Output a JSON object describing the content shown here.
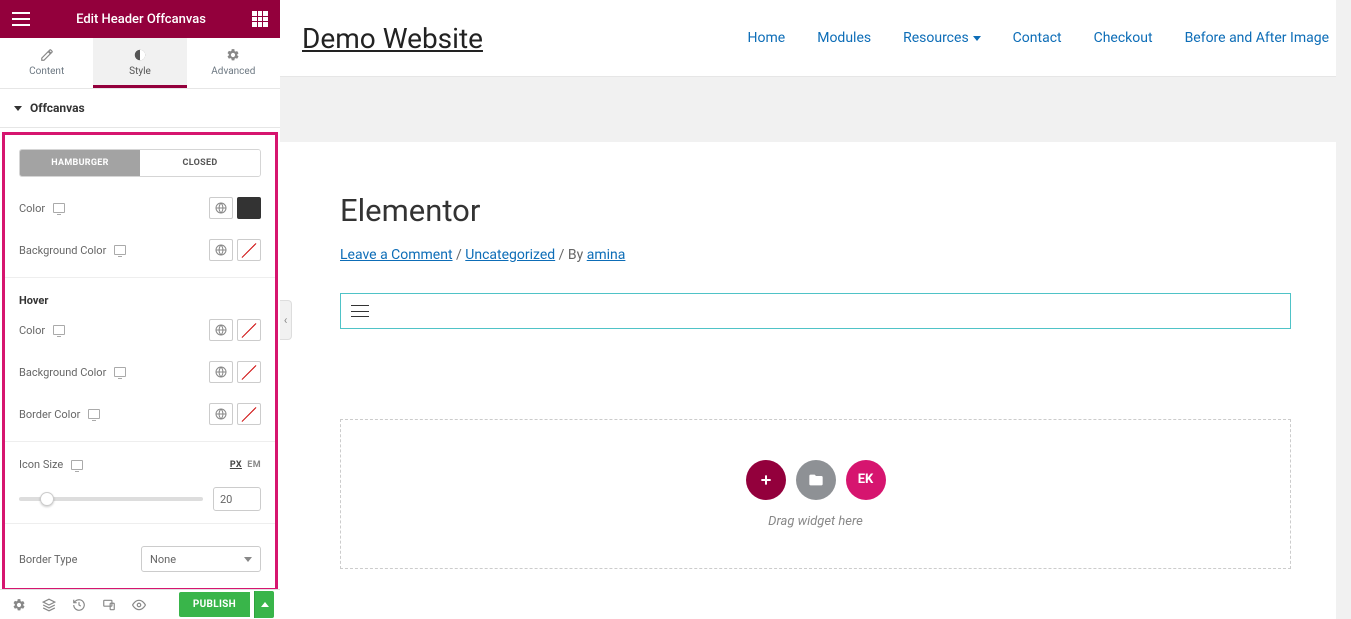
{
  "header": {
    "title": "Edit Header Offcanvas"
  },
  "tabs": {
    "content": "Content",
    "style": "Style",
    "advanced": "Advanced"
  },
  "section": {
    "title": "Offcanvas"
  },
  "toggle": {
    "hamburger": "HAMBURGER",
    "closed": "CLOSED"
  },
  "controls": {
    "color": "Color",
    "bgcolor": "Background Color",
    "hover": "Hover",
    "border_color": "Border Color",
    "icon_size": "Icon Size",
    "icon_size_value": "20",
    "px": "PX",
    "em": "EM",
    "border_type": "Border Type",
    "border_type_value": "None"
  },
  "footer": {
    "publish": "PUBLISH"
  },
  "site": {
    "title": "Demo Website",
    "nav": {
      "home": "Home",
      "modules": "Modules",
      "resources": "Resources",
      "contact": "Contact",
      "checkout": "Checkout",
      "before_after": "Before and After Image"
    },
    "page_title": "Elementor",
    "meta": {
      "leave_comment": "Leave a Comment",
      "sep1": " / ",
      "category": "Uncategorized",
      "sep2": " / By ",
      "author": "amina"
    },
    "dropzone": {
      "text": "Drag widget here",
      "ek": "EK"
    }
  }
}
